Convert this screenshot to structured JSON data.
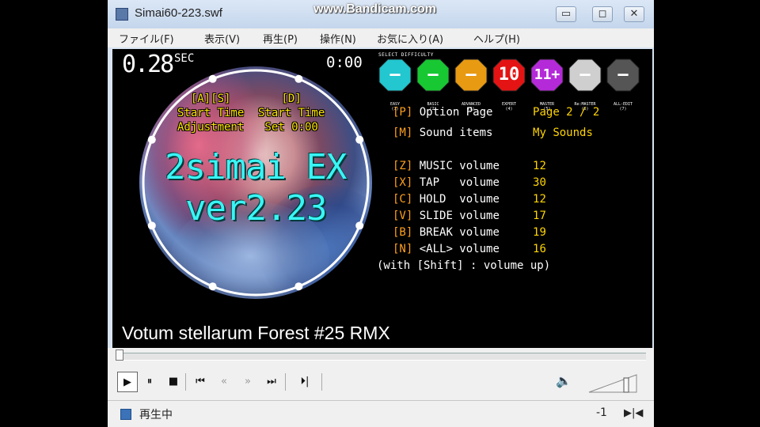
{
  "window": {
    "title": "Simai60-223.swf",
    "watermark": "www.Bandicam.com",
    "controls": {
      "minimize": "▭",
      "maximize": "◻",
      "close": "✕"
    }
  },
  "menu": [
    "ファイル(F)",
    "表示(V)",
    "再生(P)",
    "操作(N)",
    "お気に入り(A)",
    "ヘルプ(H)"
  ],
  "stage": {
    "timer_value": "0.28",
    "timer_unit": "SEC",
    "time_right": "0:00",
    "start_left": [
      "[A][S]",
      "Start Time",
      "Adjustment"
    ],
    "start_right": [
      "[D]",
      "Start Time",
      "Set 0:00"
    ],
    "title_line1": "2simai EX",
    "title_line2": "ver2.23",
    "select_caption": "SELECT DIFFICULTY",
    "difficulties": [
      {
        "label": "—",
        "caption": "EASY\n(1)",
        "color": "#22c7d0",
        "icon": "octagon-icon"
      },
      {
        "label": "—",
        "caption": "BASIC\n(2)",
        "color": "#18c832",
        "icon": "octagon-icon"
      },
      {
        "label": "—",
        "caption": "ADVANCED\n(3)",
        "color": "#e89a12",
        "icon": "octagon-icon"
      },
      {
        "label": "10",
        "caption": "EXPERT\n(4)",
        "color": "#e41414",
        "icon": "octagon-icon"
      },
      {
        "label": "11+",
        "caption": "MASTER\n(5)",
        "color": "#b42ad8",
        "icon": "octagon-icon"
      },
      {
        "label": "—",
        "caption": "Re:MASTER\n(6)",
        "color": "#cfcfcf",
        "icon": "octagon-icon"
      },
      {
        "label": "—",
        "caption": "ALL-EDIT\n(7)",
        "color": "#555555",
        "icon": "octagon-icon"
      }
    ],
    "option_page": {
      "key": "[P]",
      "label": "Option Page",
      "value": "Page 2 / 2"
    },
    "sound_items": {
      "key": "[M]",
      "label": "Sound items",
      "value": "My Sounds"
    },
    "volumes": [
      {
        "key": "[Z]",
        "label": "MUSIC volume",
        "value": "12"
      },
      {
        "key": "[X]",
        "label": "TAP   volume",
        "value": "30"
      },
      {
        "key": "[C]",
        "label": "HOLD  volume",
        "value": "12"
      },
      {
        "key": "[V]",
        "label": "SLIDE volume",
        "value": "17"
      },
      {
        "key": "[B]",
        "label": "BREAK volume",
        "value": "19"
      },
      {
        "key": "[N]",
        "label": "<ALL> volume",
        "value": "16"
      }
    ],
    "shift_note": "(with [Shift] : volume up)",
    "song_title": "Votum stellarum Forest #25 RMX"
  },
  "controls": {
    "play": "▶",
    "pause": "⏸",
    "stop": "■",
    "prev": "⏮",
    "rewind": "«",
    "forward": "»",
    "next": "⏭",
    "step": "⏵|",
    "volume_icon": "speaker-icon",
    "seek_position": 0.0
  },
  "status": {
    "text": "再生中",
    "right_value": "-1",
    "end_label": "▶|◀"
  }
}
